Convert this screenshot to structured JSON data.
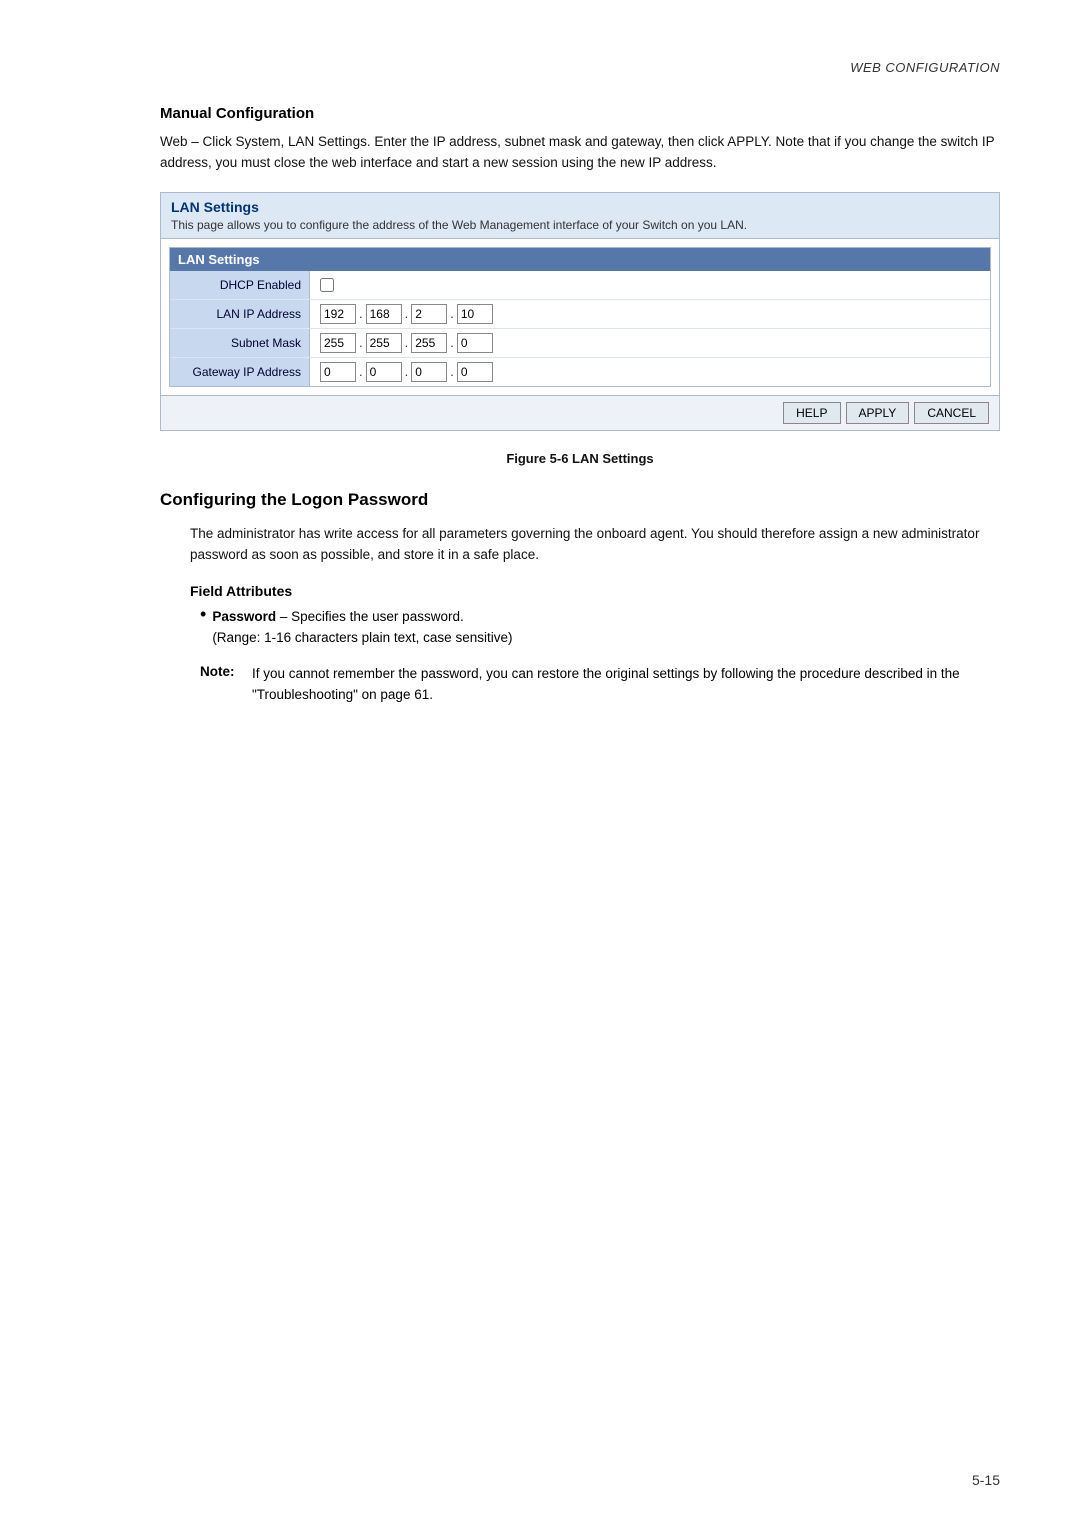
{
  "header": {
    "title": "Web Configuration",
    "title_display": "WEB CONFIGURATION"
  },
  "manual_config": {
    "title": "Manual Configuration",
    "body": "Web – Click System, LAN Settings. Enter the IP address, subnet mask and gateway, then click APPLY. Note that if you change the switch IP address, you must close the web interface and start a new session using the new IP address."
  },
  "lan_settings_panel": {
    "outer_title": "LAN Settings",
    "outer_desc": "This page allows you to configure the address of the Web Management interface of your Switch on you LAN.",
    "inner_title": "LAN Settings",
    "rows": [
      {
        "label": "DHCP Enabled",
        "type": "checkbox",
        "value": false
      },
      {
        "label": "LAN IP Address",
        "type": "ip",
        "octets": [
          "192",
          "168",
          "2",
          "10"
        ]
      },
      {
        "label": "Subnet Mask",
        "type": "ip",
        "octets": [
          "255",
          "255",
          "255",
          "0"
        ]
      },
      {
        "label": "Gateway IP Address",
        "type": "ip",
        "octets": [
          "0",
          "0",
          "0",
          "0"
        ]
      }
    ],
    "buttons": {
      "help": "HELP",
      "apply": "APPLY",
      "cancel": "CANCEL"
    }
  },
  "figure_caption": "Figure 5-6  LAN Settings",
  "logon_section": {
    "title": "Configuring the Logon Password",
    "intro": "The administrator has write access for all parameters governing the onboard agent. You should therefore assign a new administrator password as soon as possible, and store it in a safe place.",
    "field_attrs_title": "Field Attributes",
    "bullet": {
      "term": "Password",
      "dash": "–",
      "desc": "Specifies the user password.",
      "range": "(Range: 1-16 characters plain text, case sensitive)"
    },
    "note": {
      "label": "Note:",
      "text": "If you cannot remember the password, you can restore the original settings by following the procedure described in the \"Troubleshooting\" on page 61."
    }
  },
  "page_number": "5-15"
}
